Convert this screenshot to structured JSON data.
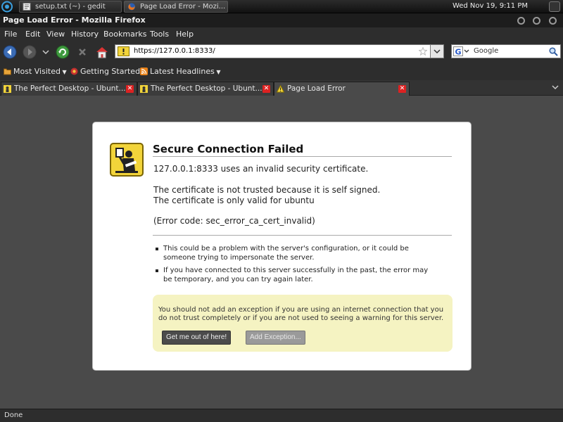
{
  "panel": {
    "tasks": [
      {
        "label": "setup.txt (~) - gedit"
      },
      {
        "label": "Page Load Error - Mozi..."
      }
    ],
    "clock": "Wed Nov 19,  9:11 PM"
  },
  "window": {
    "title": "Page Load Error - Mozilla Firefox"
  },
  "menubar": {
    "items": [
      {
        "label": "File"
      },
      {
        "label": "Edit"
      },
      {
        "label": "View"
      },
      {
        "label": "History"
      },
      {
        "label": "Bookmarks"
      },
      {
        "label": "Tools"
      },
      {
        "label": "Help"
      }
    ]
  },
  "navbar": {
    "url": "https://127.0.0.1:8333/",
    "search_engine": "Google"
  },
  "bookmarks": {
    "items": [
      {
        "label": "Most Visited"
      },
      {
        "label": "Getting Started"
      },
      {
        "label": "Latest Headlines"
      }
    ]
  },
  "tabs": [
    {
      "label": "The Perfect Desktop - Ubunt..."
    },
    {
      "label": "The Perfect Desktop - Ubunt..."
    },
    {
      "label": "Page Load Error"
    }
  ],
  "error": {
    "title": "Secure Connection Failed",
    "line1": "127.0.0.1:8333 uses an invalid security certificate.",
    "line2": "The certificate is not trusted because it is self signed.",
    "line3": "The certificate is only valid for ubuntu",
    "code": "(Error code: sec_error_ca_cert_invalid)",
    "bullets": [
      "This could be a problem with the server's configuration, or it could be someone trying to impersonate the server.",
      "If you have connected to this server successfully in the past, the error may be temporary, and you can try again later."
    ],
    "warning": "You should not add an exception if you are using an internet connection that you do not trust completely or if you are not used to seeing a warning for this server.",
    "btn_out": "Get me out of here!",
    "btn_exception": "Add Exception..."
  },
  "status": {
    "text": "Done"
  }
}
